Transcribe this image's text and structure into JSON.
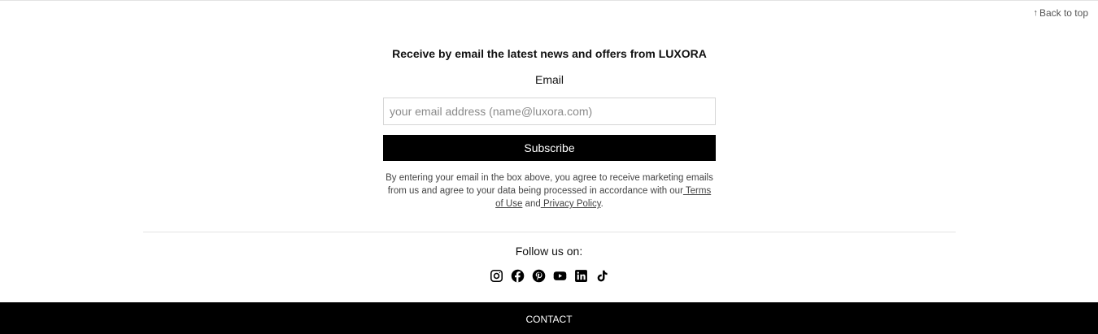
{
  "back_to_top": {
    "arrow": "↑",
    "label": "Back to top"
  },
  "newsletter": {
    "heading": "Receive by email the latest news and offers from LUXORA",
    "email_label": "Email",
    "email_value": "",
    "email_placeholder": "your email address (name@luxora.com)",
    "subscribe_label": "Subscribe",
    "disclaimer_text": "By entering your email in the box above, you agree to receive marketing emails from us and agree to your data being processed in accordance with our",
    "terms_link": " Terms of Use",
    "and_text": " and",
    "privacy_link": " Privacy Policy",
    "period": "."
  },
  "social": {
    "label": "Follow us on:",
    "icons": [
      "instagram-icon",
      "facebook-icon",
      "pinterest-icon",
      "youtube-icon",
      "linkedin-icon",
      "tiktok-icon"
    ]
  },
  "footer": {
    "contact_label": "CONTACT"
  },
  "colors": {
    "primary": "#000000",
    "background": "#ffffff",
    "divider": "#e3e3e3",
    "muted_text": "#444444"
  }
}
